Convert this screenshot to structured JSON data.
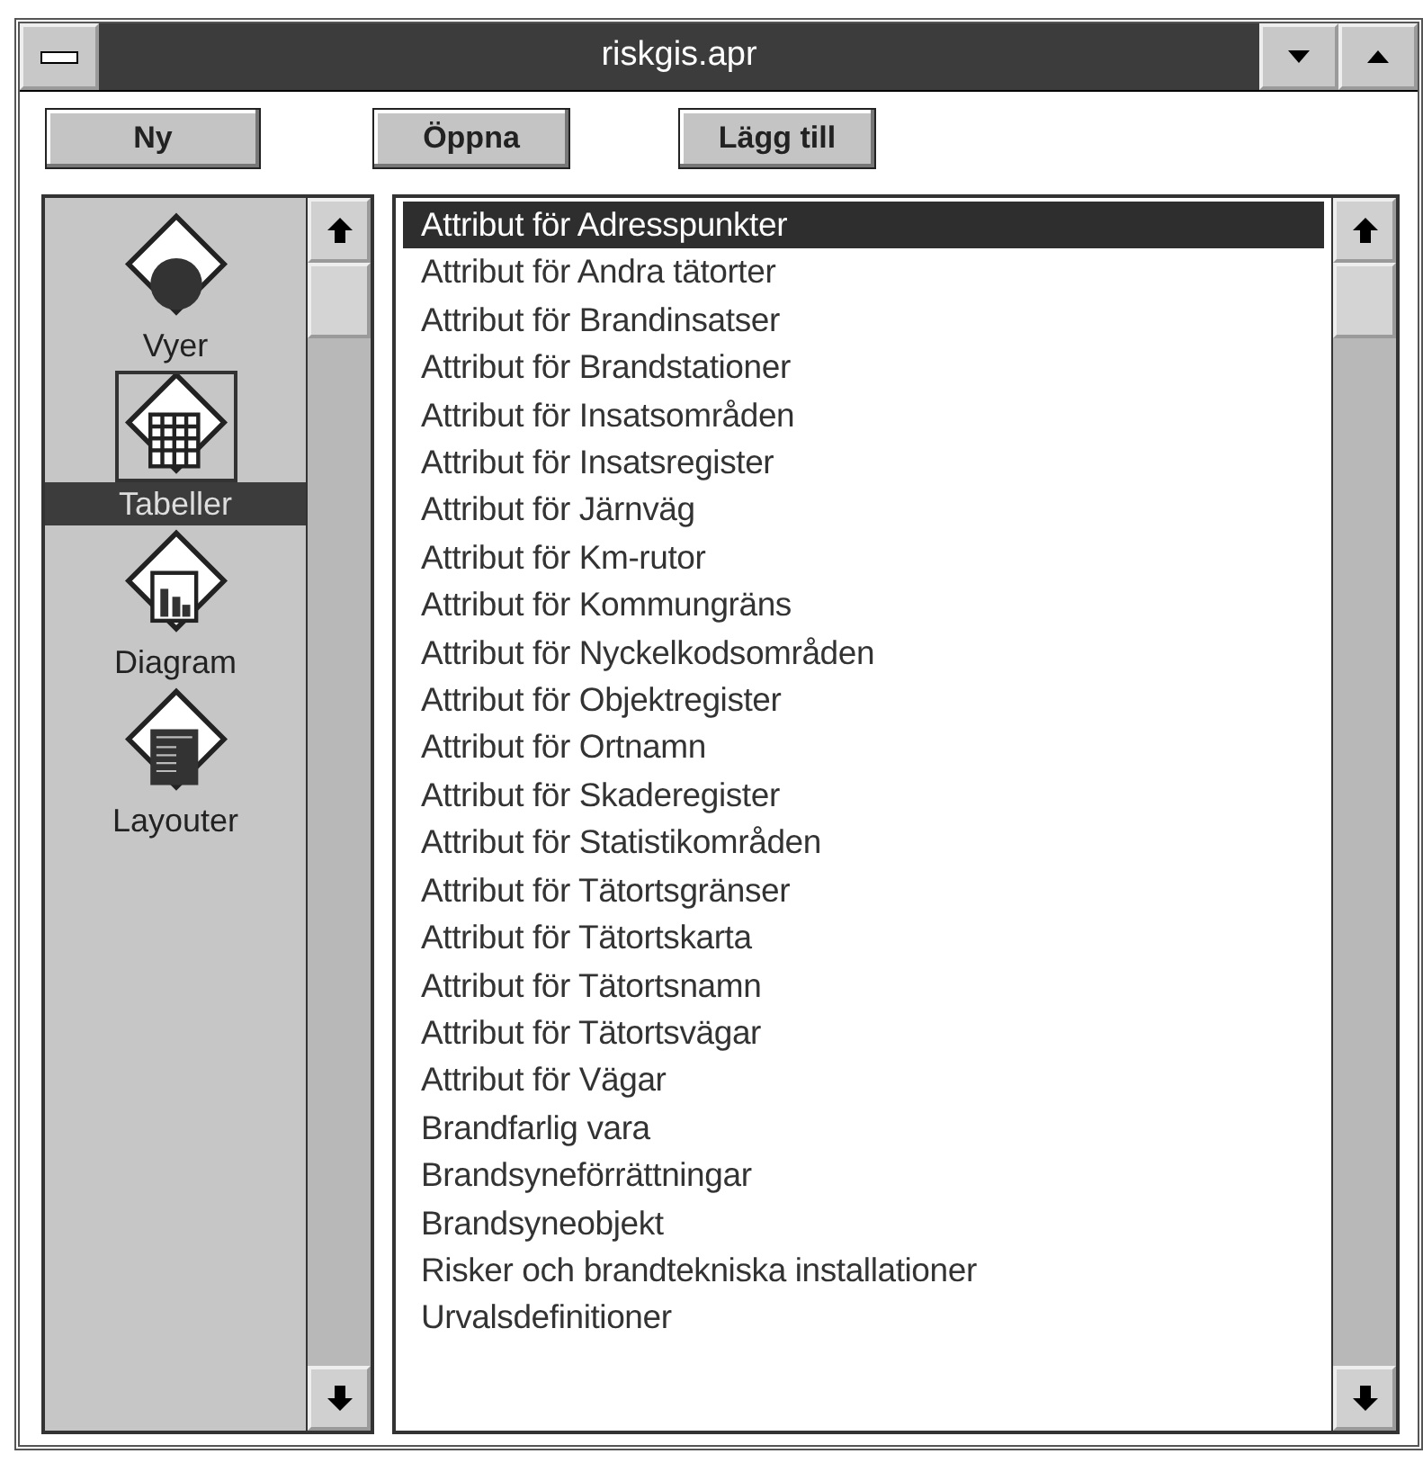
{
  "window": {
    "title": "riskgis.apr"
  },
  "toolbar": [
    {
      "label": "Ny"
    },
    {
      "label": "Öppna"
    },
    {
      "label": "Lägg till"
    }
  ],
  "categories": [
    {
      "label": "Vyer",
      "kind": "views",
      "selected": false
    },
    {
      "label": "Tabeller",
      "kind": "tables",
      "selected": true
    },
    {
      "label": "Diagram",
      "kind": "charts",
      "selected": false
    },
    {
      "label": "Layouter",
      "kind": "layouts",
      "selected": false
    }
  ],
  "documents": [
    {
      "label": "Attribut för Adresspunkter",
      "selected": true
    },
    {
      "label": "Attribut för Andra tätorter",
      "selected": false
    },
    {
      "label": "Attribut för Brandinsatser",
      "selected": false
    },
    {
      "label": "Attribut för Brandstationer",
      "selected": false
    },
    {
      "label": "Attribut för Insatsområden",
      "selected": false
    },
    {
      "label": "Attribut för Insatsregister",
      "selected": false
    },
    {
      "label": "Attribut för Järnväg",
      "selected": false
    },
    {
      "label": "Attribut för Km-rutor",
      "selected": false
    },
    {
      "label": "Attribut för Kommungräns",
      "selected": false
    },
    {
      "label": "Attribut för Nyckelkodsområden",
      "selected": false
    },
    {
      "label": "Attribut för Objektregister",
      "selected": false
    },
    {
      "label": "Attribut för Ortnamn",
      "selected": false
    },
    {
      "label": "Attribut för Skaderegister",
      "selected": false
    },
    {
      "label": "Attribut för Statistikområden",
      "selected": false
    },
    {
      "label": "Attribut för Tätortsgränser",
      "selected": false
    },
    {
      "label": "Attribut för Tätortskarta",
      "selected": false
    },
    {
      "label": "Attribut för Tätortsnamn",
      "selected": false
    },
    {
      "label": "Attribut för Tätortsvägar",
      "selected": false
    },
    {
      "label": "Attribut för Vägar",
      "selected": false
    },
    {
      "label": "Brandfarlig vara",
      "selected": false
    },
    {
      "label": "Brandsyneförrättningar",
      "selected": false
    },
    {
      "label": "Brandsyneobjekt",
      "selected": false
    },
    {
      "label": "Risker och brandtekniska installationer",
      "selected": false
    },
    {
      "label": "Urvalsdefinitioner",
      "selected": false
    }
  ]
}
